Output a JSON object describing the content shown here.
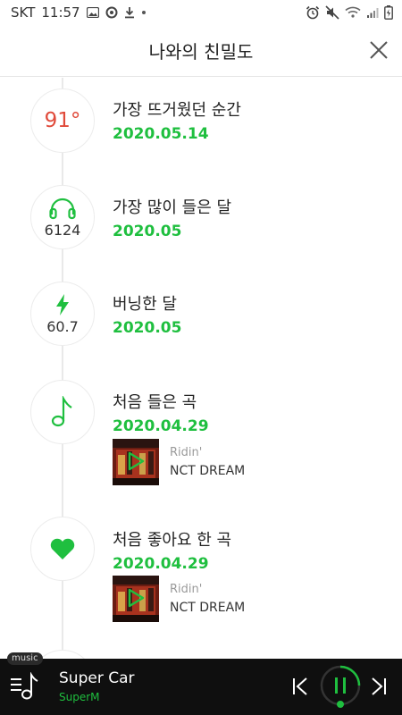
{
  "status_bar": {
    "carrier": "SKT",
    "time": "11:57"
  },
  "header": {
    "title": "나와의 친밀도"
  },
  "items": [
    {
      "badge": "91°",
      "label": "가장 뜨거웠던 순간",
      "date": "2020.05.14"
    },
    {
      "badge": "6124",
      "label": "가장 많이 들은 달",
      "date": "2020.05"
    },
    {
      "badge": "60.7",
      "label": "버닝한 달",
      "date": "2020.05"
    },
    {
      "label": "처음 들은 곡",
      "date": "2020.04.29",
      "song": {
        "title": "Ridin'",
        "artist": "NCT DREAM"
      }
    },
    {
      "label": "처음 좋아요 한 곡",
      "date": "2020.04.29",
      "song": {
        "title": "Ridin'",
        "artist": "NCT DREAM"
      }
    }
  ],
  "player": {
    "tab_label": "music",
    "title": "Super Car",
    "artist": "SuperM"
  },
  "colors": {
    "accent": "#1fbf3f",
    "hot": "#e04a3a",
    "player_bg": "#0f0f0f"
  },
  "icons": [
    "headphones-icon",
    "lightning-icon",
    "music-note-icon",
    "heart-icon",
    "close-icon",
    "previous-icon",
    "pause-icon",
    "next-icon"
  ]
}
